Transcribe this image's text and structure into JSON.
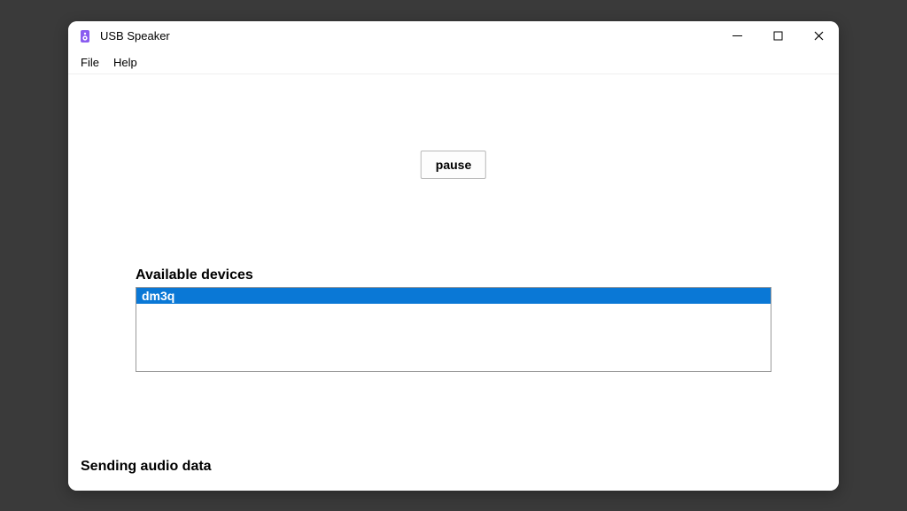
{
  "window": {
    "title": "USB Speaker"
  },
  "menu": {
    "file": "File",
    "help": "Help"
  },
  "main": {
    "pause_label": "pause",
    "devices_heading": "Available devices",
    "devices": [
      {
        "name": "dm3q",
        "selected": true
      }
    ],
    "status": "Sending audio data"
  }
}
